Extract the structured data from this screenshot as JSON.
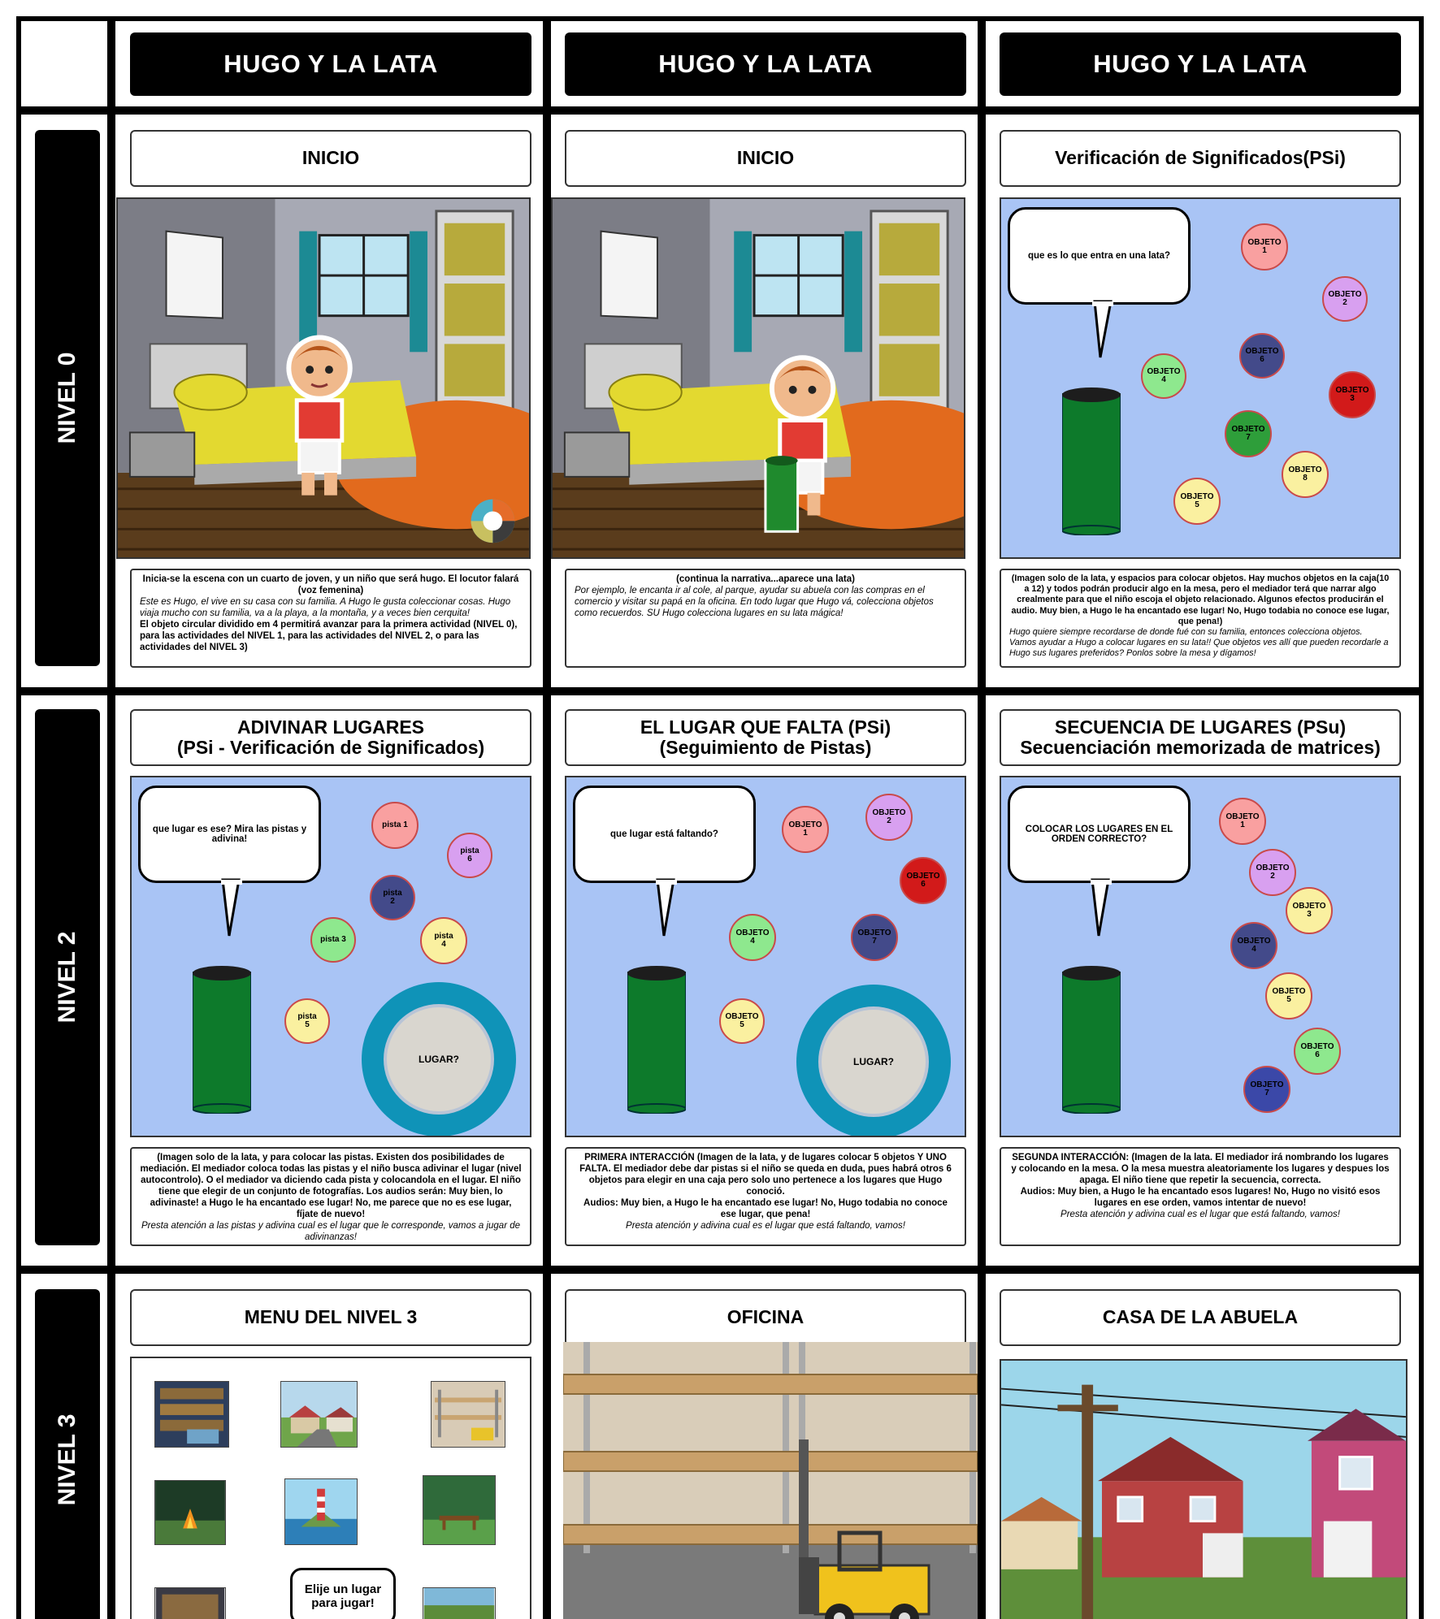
{
  "columns": [
    "HUGO Y LA LATA",
    "HUGO Y LA LATA",
    "HUGO Y LA LATA"
  ],
  "rows": [
    "NIVEL 0",
    "NIVEL 2",
    "NIVEL 3"
  ],
  "cells": {
    "r0c0": {
      "title": "INICIO",
      "text_a": "Inicia-se la escena con un cuarto de joven, y un niño que será hugo. El locutor falará (voz femenina)",
      "text_b": "Este es Hugo, el vive en su casa con su familia. A Hugo le gusta coleccionar cosas. Hugo viaja mucho con su familia, va a la playa, a la montaña, y a veces bien cerquita!",
      "text_c": "El objeto circular dividido em 4 permitirá avanzar para la primera actividad (NIVEL 0), para las actividades del NIVEL 1, para las actividades del NIVEL 2, o para las actividades del NIVEL 3)"
    },
    "r0c1": {
      "title": "INICIO",
      "text_a": "(continua la narrativa...aparece una lata)",
      "text_b": "Por ejemplo, le encanta ir al cole, al parque, ayudar su abuela con las compras en el comercio y visitar su papá en la oficina.  En todo lugar que Hugo vá, colecciona objetos como recuerdos. SU Hugo colecciona lugares en su lata mágica!"
    },
    "r0c2": {
      "title": "Verificación de Significados(PSi)",
      "bubble": "que es lo que entra en una lata?",
      "dots": [
        "OBJETO\n1",
        "OBJETO\n2",
        "OBJETO\n6",
        "OBJETO\n4",
        "OBJETO\n3",
        "OBJETO\n7",
        "OBJETO\n8",
        "OBJETO\n5"
      ],
      "text_a": "(Imagen solo de la lata, y espacios para colocar objetos. Hay muchos objetos en la caja(10 a 12) y todos podrán producir algo en la mesa, pero el mediador terá que narrar algo crealmente para que el niño escoja el objeto relacionado. Algunos efectos producirán el audio. Muy bien, a Hugo le ha encantado ese lugar! No, Hugo todabia no conoce ese lugar, que pena!)",
      "text_b": "Hugo quiere siempre recordarse de donde fué con su familia, entonces colecciona objetos. Vamos ayudar a Hugo a colocar lugares en su lata!! Que objetos ves allí que pueden recordarle a Hugo sus lugares preferidos? Ponlos sobre la mesa y dígamos!"
    },
    "r1c0": {
      "title_1": "ADIVINAR LUGARES",
      "title_2": "(PSi - Verificación de Significados)",
      "bubble": "que lugar es ese? Mira las pistas y adivina!",
      "dots": [
        "pista 1",
        "pista\n6",
        "pista\n2",
        "pista 3",
        "pista\n4",
        "pista\n5"
      ],
      "lugar": "LUGAR?",
      "text_a": "(Imagen solo de la lata, y para colocar las pistas.  Existen dos posibilidades de mediación. El mediador coloca todas las pistas y el niño busca adivinar el lugar (nivel autocontrolo). O el mediador va diciendo cada pista y colocandola en el lugar. El niño tiene que elegir de un conjunto de fotografías. Los audios serán: Muy bien, lo adivinaste! a Hugo le ha encantado ese lugar! No, me parece que no es ese lugar, fíjate de nuevo!",
      "text_b": "Presta atención a las pistas y adivina cual es el lugar que le corresponde, vamos a jugar de adivinanzas!"
    },
    "r1c1": {
      "title_1": "EL LUGAR QUE FALTA (PSi)",
      "title_2": "(Seguimiento de Pistas)",
      "bubble": "que lugar está faltando?",
      "dots": [
        "OBJETO\n1",
        "OBJETO\n2",
        "OBJETO\n6",
        "OBJETO\n4",
        "OBJETO\n7",
        "OBJETO\n5"
      ],
      "lugar": "LUGAR?",
      "text_a": "PRIMERA INTERACCIÓN (Imagen de la lata, y de lugares  colocar 5 objetos Y UNO FALTA. El mediador debe dar pistas si el niño se queda en duda, pues habrá otros 6 objetos para elegir en una caja pero solo uno pertenece a los lugares que Hugo conoció.",
      "text_b": "Audios: Muy bien, a Hugo le ha encantado ese lugar! No, Hugo todabia no conoce ese lugar, que pena!",
      "text_c": "Presta atención y adivina cual es el lugar que está faltando, vamos!"
    },
    "r1c2": {
      "title_1": "SECUENCIA DE LUGARES (PSu)",
      "title_2": "Secuenciación memorizada de matrices)",
      "bubble": "COLOCAR LOS LUGARES EN EL ORDEN CORRECTO?",
      "dots": [
        "OBJETO\n1",
        "OBJETO\n2",
        "OBJETO\n3",
        "OBJETO\n4",
        "OBJETO\n5",
        "OBJETO\n6",
        "OBJETO\n7"
      ],
      "text_a": "SEGUNDA INTERACCIÓN:  (Imagen de la lata. El mediador irá nombrando los lugares y colocando en la mesa. O la mesa muestra aleatoriamente los lugares y despues los apaga. El niño tiene que repetir la secuencia, correcta.",
      "text_b": "Audios: Muy bien, a Hugo le ha encantado esos lugares! No, Hugo no visitó esos lugares en ese orden, vamos intentar de nuevo!",
      "text_c": "Presta atención y adivina cual es el lugar que está faltando, vamos!"
    },
    "r2c0": {
      "title": "MENU DEL NIVEL 3",
      "menu_bubble": "Elije un lugar\npara jugar!"
    },
    "r2c1": {
      "title": "OFICINA"
    },
    "r2c2": {
      "title": "CASA DE LA ABUELA"
    }
  },
  "colors": {
    "frame": "#000000",
    "panel_bg": "#a9c4f5",
    "can_green": "#0d7a2b",
    "ring_teal": "#0f93b8",
    "dot_red_light": "#f9a0a0",
    "dot_purple": "#d8a0f0",
    "dot_navy": "#434a8a",
    "dot_green": "#8ee88e",
    "dot_yellow": "#faf0a0",
    "dot_red_dark": "#d21a1a"
  }
}
